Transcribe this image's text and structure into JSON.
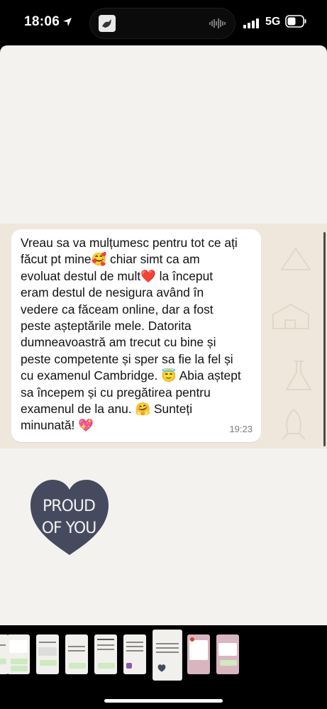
{
  "status_bar": {
    "time": "18:06",
    "network": "5G"
  },
  "chat": {
    "message_lines": [
      "Vreau sa va mulțumesc pentru tot ce ați",
      "făcut pt mine🥰 chiar simt ca am",
      "evoluat destul de mult❤️ la început",
      "eram destul de nesigura având în",
      "vedere ca făceam online, dar a fost",
      "peste așteptările mele. Datorita",
      "dumneavoastră am trecut cu bine și",
      "peste competente și sper sa fie la fel și",
      "cu examenul Cambridge. 😇 Abia aștept",
      "sa începem și cu pregătirea pentru",
      "examenul de la anu. 🤗 Sunteți",
      "minunată! 💖"
    ],
    "timestamp": "19:23"
  },
  "sticker": {
    "line1": "PROUD",
    "line2": "OF YOU",
    "color": "#454a5e"
  },
  "thumbnails": {
    "count": 10,
    "active_index": 6
  }
}
